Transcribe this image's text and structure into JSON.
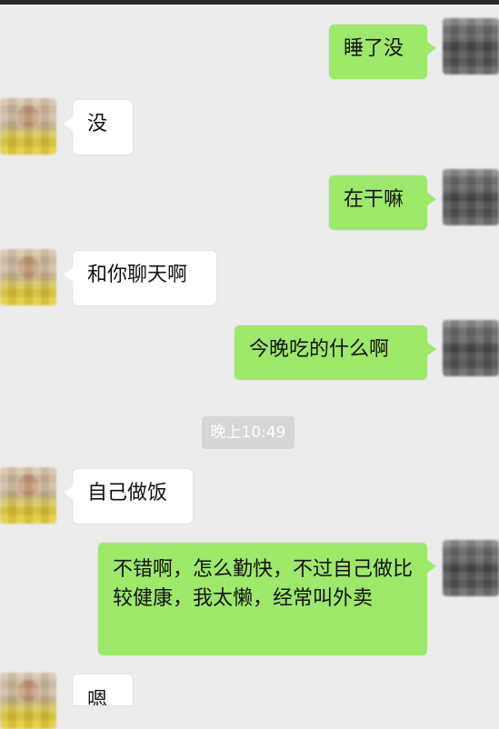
{
  "timestamp": "晚上10:49",
  "messages": [
    {
      "sender": "me",
      "text": "睡了没"
    },
    {
      "sender": "friend",
      "text": "没"
    },
    {
      "sender": "me",
      "text": "在干嘛"
    },
    {
      "sender": "friend",
      "text": "和你聊天啊"
    },
    {
      "sender": "me",
      "text": "今晚吃的什么啊"
    },
    {
      "sender": "friend",
      "text": "自己做饭"
    },
    {
      "sender": "me",
      "text": "不错啊，怎么勤快，不过自己做比较健康，我太懒，经常叫外卖"
    },
    {
      "sender": "friend",
      "text": "嗯"
    }
  ],
  "colors": {
    "background": "#ececec",
    "sent_bubble": "#9ee86a",
    "received_bubble": "#ffffff",
    "timestamp_bg": "#d6d6d6"
  }
}
